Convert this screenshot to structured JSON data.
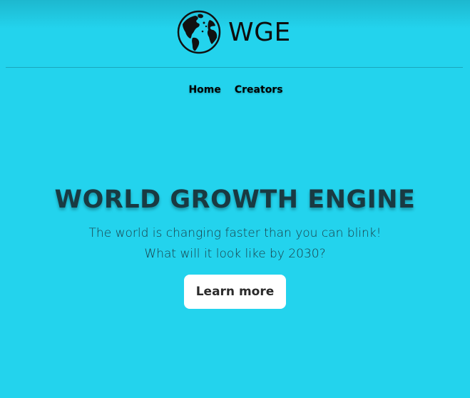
{
  "header": {
    "brand_name": "WGE"
  },
  "nav": {
    "items": [
      {
        "label": "Home"
      },
      {
        "label": "Creators"
      }
    ]
  },
  "hero": {
    "title": "WORLD GROWTH ENGINE",
    "subtitle_line1": "The world is changing faster than you can blink!",
    "subtitle_line2": "What will it look like by 2030?",
    "cta_label": "Learn more"
  },
  "colors": {
    "background": "#23d3ed",
    "title_text": "#193a42",
    "button_bg": "#ffffff"
  },
  "icons": {
    "logo": "globe-icon"
  }
}
